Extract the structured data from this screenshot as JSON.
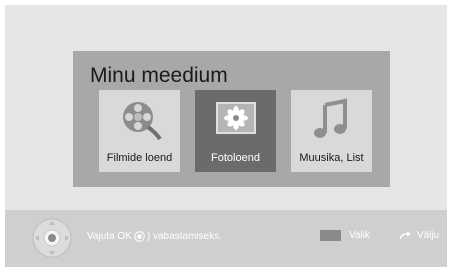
{
  "panel": {
    "title": "Minu meedium"
  },
  "tiles": [
    {
      "label": "Filmide loend",
      "icon": "film-reel-icon",
      "selected": false
    },
    {
      "label": "Fotoloend",
      "icon": "photo-icon",
      "selected": true
    },
    {
      "label": "Muusika, List",
      "icon": "music-note-icon",
      "selected": false
    }
  ],
  "bottom_bar": {
    "hint_before": "Vajuta OK",
    "hint_after": ") vabastamiseks.",
    "valik_label": "Valik",
    "valju_label": "Välju"
  },
  "colors": {
    "panel_bg": "#a8a8a8",
    "tile_bg": "#d9d9d9",
    "tile_selected_bg": "#6b6b6b",
    "screen_bg": "#e6e6e6",
    "bar_bg": "#cfcfcf"
  }
}
